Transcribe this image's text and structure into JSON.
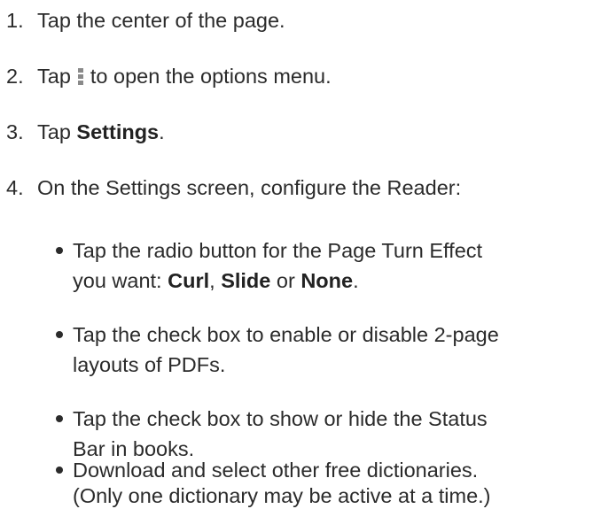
{
  "steps": [
    {
      "number": "1.",
      "text": "Tap the center of the page."
    },
    {
      "number": "2.",
      "text_before": "Tap",
      "icon": "options-menu-icon",
      "text_after": "to open the options menu."
    },
    {
      "number": "3.",
      "text_before": "Tap ",
      "bold": "Settings",
      "text_after": "."
    },
    {
      "number": "4.",
      "text": "On the Settings screen, configure the Reader:"
    }
  ],
  "bullets": [
    {
      "line1": "Tap the radio button for the Page Turn Effect",
      "line2_before": "you want: ",
      "opt1": "Curl",
      "sep1": ", ",
      "opt2": "Slide",
      "sep2": " or ",
      "opt3": "None",
      "line2_after": "."
    },
    {
      "line1": "Tap the check box to enable or disable 2-page",
      "line2": "layouts of PDFs."
    },
    {
      "line1": "Tap the check box to show or hide the Status",
      "line2": "Bar in books."
    },
    {
      "line1": "Download and select other free dictionaries.",
      "line2": "(Only one dictionary may be active at a time.)"
    }
  ]
}
